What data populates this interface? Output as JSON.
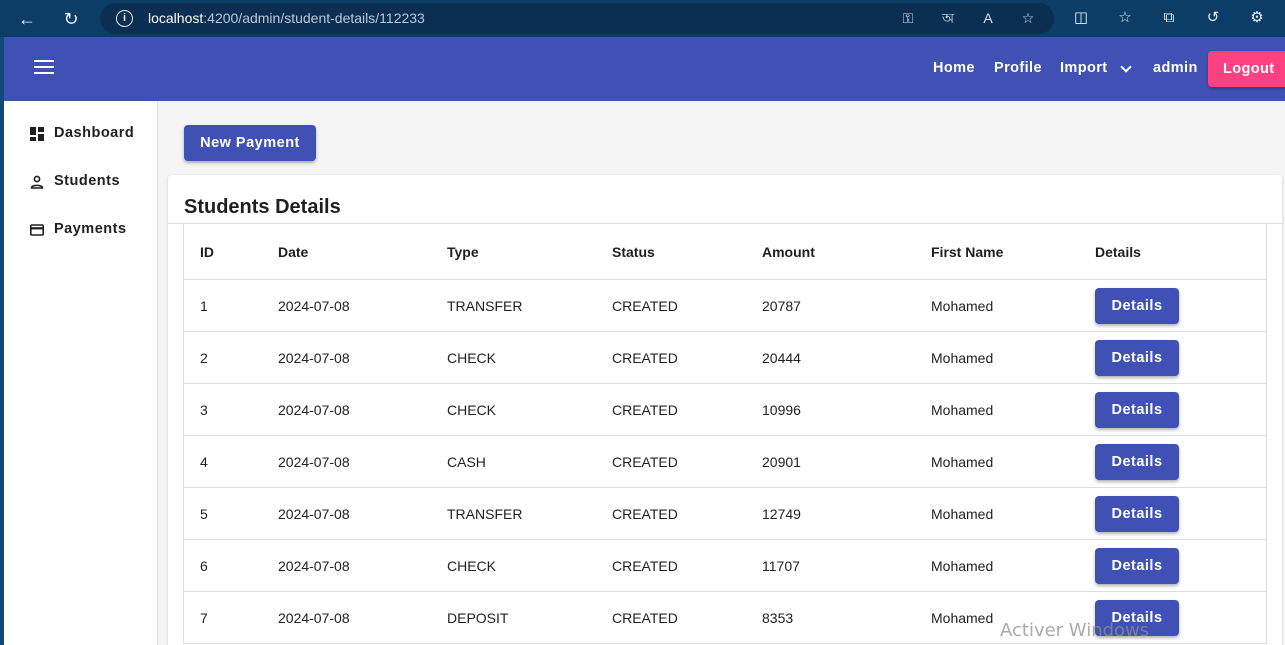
{
  "browser": {
    "url_host": "localhost",
    "url_path": ":4200/admin/student-details/112233"
  },
  "toolbar": {
    "nav": [
      "Home",
      "Profile",
      "Import",
      "admin"
    ],
    "logout_label": "Logout"
  },
  "sidebar": {
    "items": [
      {
        "label": "Dashboard",
        "icon": "dashboard-icon"
      },
      {
        "label": "Students",
        "icon": "person-icon"
      },
      {
        "label": "Payments",
        "icon": "credit-card-icon"
      }
    ]
  },
  "main": {
    "new_payment_label": "New Payment",
    "title": "Students Details"
  },
  "table": {
    "headers": [
      "ID",
      "Date",
      "Type",
      "Status",
      "Amount",
      "First Name",
      "Details"
    ],
    "details_label": "Details",
    "rows": [
      [
        "1",
        "2024-07-08",
        "TRANSFER",
        "CREATED",
        "20787",
        "Mohamed"
      ],
      [
        "2",
        "2024-07-08",
        "CHECK",
        "CREATED",
        "20444",
        "Mohamed"
      ],
      [
        "3",
        "2024-07-08",
        "CHECK",
        "CREATED",
        "10996",
        "Mohamed"
      ],
      [
        "4",
        "2024-07-08",
        "CASH",
        "CREATED",
        "20901",
        "Mohamed"
      ],
      [
        "5",
        "2024-07-08",
        "TRANSFER",
        "CREATED",
        "12749",
        "Mohamed"
      ],
      [
        "6",
        "2024-07-08",
        "CHECK",
        "CREATED",
        "11707",
        "Mohamed"
      ],
      [
        "7",
        "2024-07-08",
        "DEPOSIT",
        "CREATED",
        "8353",
        "Mohamed"
      ]
    ]
  },
  "watermark": "Activer Windows",
  "colors": {
    "primary": "#3f51b5",
    "accent": "#ff4081",
    "browser": "#0b3d66"
  }
}
